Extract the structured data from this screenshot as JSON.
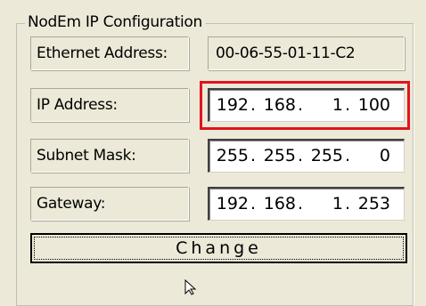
{
  "group": {
    "title": "NodEm IP Configuration"
  },
  "fields": {
    "ethernet": {
      "label": "Ethernet Address:",
      "value": "00-06-55-01-11-C2"
    },
    "ip": {
      "label": "IP Address:",
      "octets": [
        "192",
        "168",
        "1",
        "100"
      ]
    },
    "subnet": {
      "label": "Subnet Mask:",
      "octets": [
        "255",
        "255",
        "255",
        "0"
      ]
    },
    "gateway": {
      "label": "Gateway:",
      "octets": [
        "192",
        "168",
        "1",
        "253"
      ]
    }
  },
  "button": {
    "change_label": "Change"
  },
  "icons": {
    "cursor": "arrow-cursor-icon"
  },
  "colors": {
    "highlight": "#e0141e",
    "background": "#ece9d8"
  }
}
